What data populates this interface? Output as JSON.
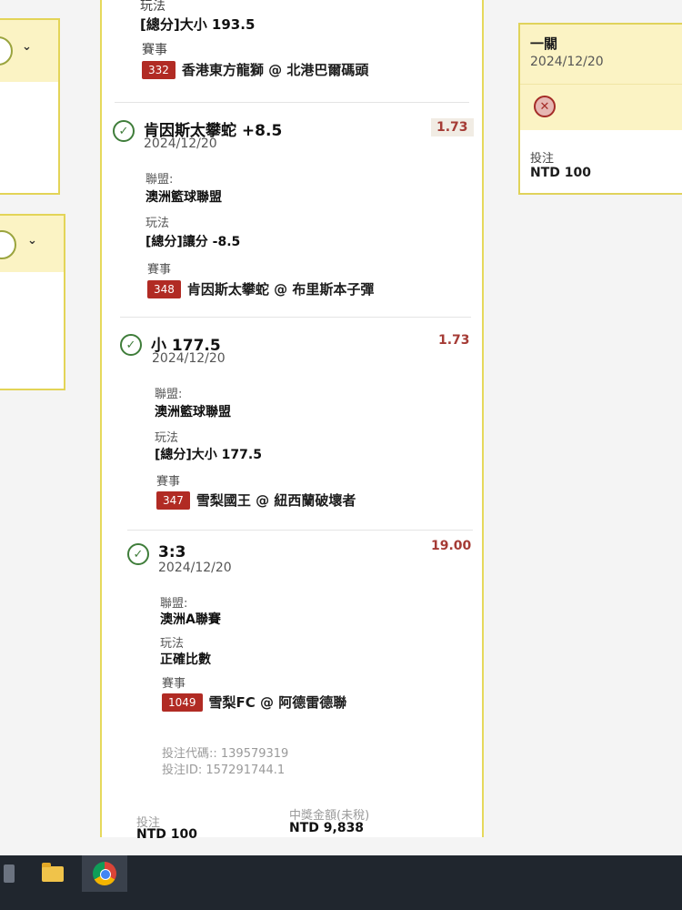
{
  "top_section": {
    "play_label": "玩法",
    "play_value": "[總分]大小 193.5",
    "event_label": "賽事",
    "event_code": "332",
    "event_name": "香港東方龍獅 @ 北港巴爾碼頭"
  },
  "bets": [
    {
      "title": "肯因斯太攀蛇 +8.5",
      "date": "2024/12/20",
      "odds": "1.73",
      "league_label": "聯盟:",
      "league": "澳洲籃球聯盟",
      "play_label": "玩法",
      "play": "[總分]讓分 -8.5",
      "event_label": "賽事",
      "event_code": "348",
      "event": "肯因斯太攀蛇 @ 布里斯本子彈"
    },
    {
      "title": "小 177.5",
      "date": "2024/12/20",
      "odds": "1.73",
      "league_label": "聯盟:",
      "league": "澳洲籃球聯盟",
      "play_label": "玩法",
      "play": "[總分]大小 177.5",
      "event_label": "賽事",
      "event_code": "347",
      "event": "雪梨國王 @ 紐西蘭破壞者"
    },
    {
      "title": "3:3",
      "date": "2024/12/20",
      "odds": "19.00",
      "league_label": "聯盟:",
      "league": "澳洲A聯賽",
      "play_label": "玩法",
      "play": "正確比數",
      "event_label": "賽事",
      "event_code": "1049",
      "event": "雪梨FC @ 阿德雷德聯"
    }
  ],
  "footer": {
    "bet_code": "投注代碼:: 139579319",
    "bet_id": "投注ID: 157291744.1",
    "stake_label": "投注",
    "stake_value": "NTD 100",
    "payout_label": "中獎金額(未稅)",
    "payout_value": "NTD 9,838"
  },
  "right_card": {
    "type": "一關",
    "date": "2024/12/20",
    "stake_label": "投注",
    "stake_value": "NTD 100"
  },
  "colors": {
    "accent_yellow": "#e6d95c",
    "header_yellow": "#fbf3c4",
    "code_red": "#b12b24",
    "odds_red": "#a53b35",
    "check_green": "#3f7d3a",
    "taskbar": "#20262e"
  }
}
